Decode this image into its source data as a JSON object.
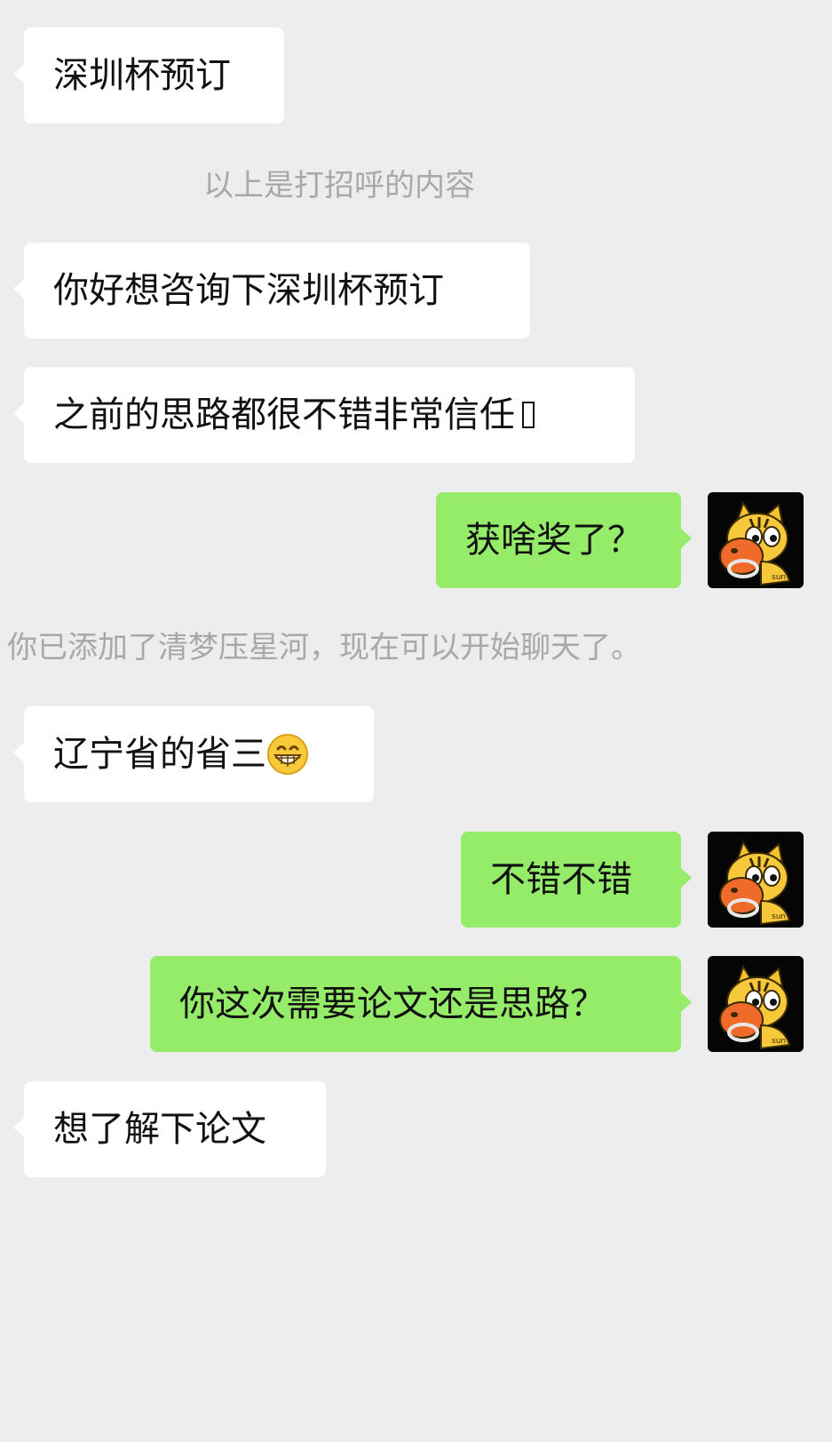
{
  "chat": {
    "messages": [
      {
        "side": "left",
        "text": "深圳杯预订"
      },
      {
        "side": "left",
        "text": "你好想咨询下深圳杯预订"
      },
      {
        "side": "left",
        "text": "之前的思路都很不错非常信任"
      },
      {
        "side": "right",
        "text": "获啥奖了？"
      },
      {
        "side": "left",
        "text": "辽宁省的省三"
      },
      {
        "side": "right",
        "text": "不错不错"
      },
      {
        "side": "right",
        "text": "你这次需要论文还是思路？"
      },
      {
        "side": "left",
        "text": "想了解下论文"
      }
    ],
    "system_notes": [
      "以上是打招呼的内容",
      "你已添加了清梦压星河，现在可以开始聊天了。"
    ],
    "emojis": {
      "grin": "grinning-face-emoji",
      "missing_glyph": "missing-glyph-box"
    },
    "colors": {
      "background": "#ededed",
      "incoming_bubble": "#ffffff",
      "outgoing_bubble": "#95ec69",
      "system_text": "#a8a8a8"
    },
    "avatar_icon": "tiger-cartoon-avatar-icon"
  }
}
